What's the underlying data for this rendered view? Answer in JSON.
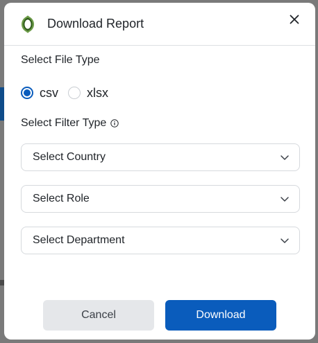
{
  "modal": {
    "title": "Download Report",
    "file_type_label": "Select File Type",
    "file_types": [
      {
        "label": "csv",
        "selected": true
      },
      {
        "label": "xlsx",
        "selected": false
      }
    ],
    "filter_type_label": "Select Filter Type",
    "filters": [
      {
        "placeholder": "Select Country"
      },
      {
        "placeholder": "Select Role"
      },
      {
        "placeholder": "Select Department"
      }
    ],
    "cancel_label": "Cancel",
    "download_label": "Download"
  },
  "colors": {
    "accent": "#0a5cbc",
    "cancel_bg": "#e5e7ea",
    "logo_green": "#5a8a3a"
  },
  "icons": {
    "logo": "shield-logo-icon",
    "close": "close-icon",
    "info": "info-icon",
    "chevron": "chevron-down-icon"
  }
}
